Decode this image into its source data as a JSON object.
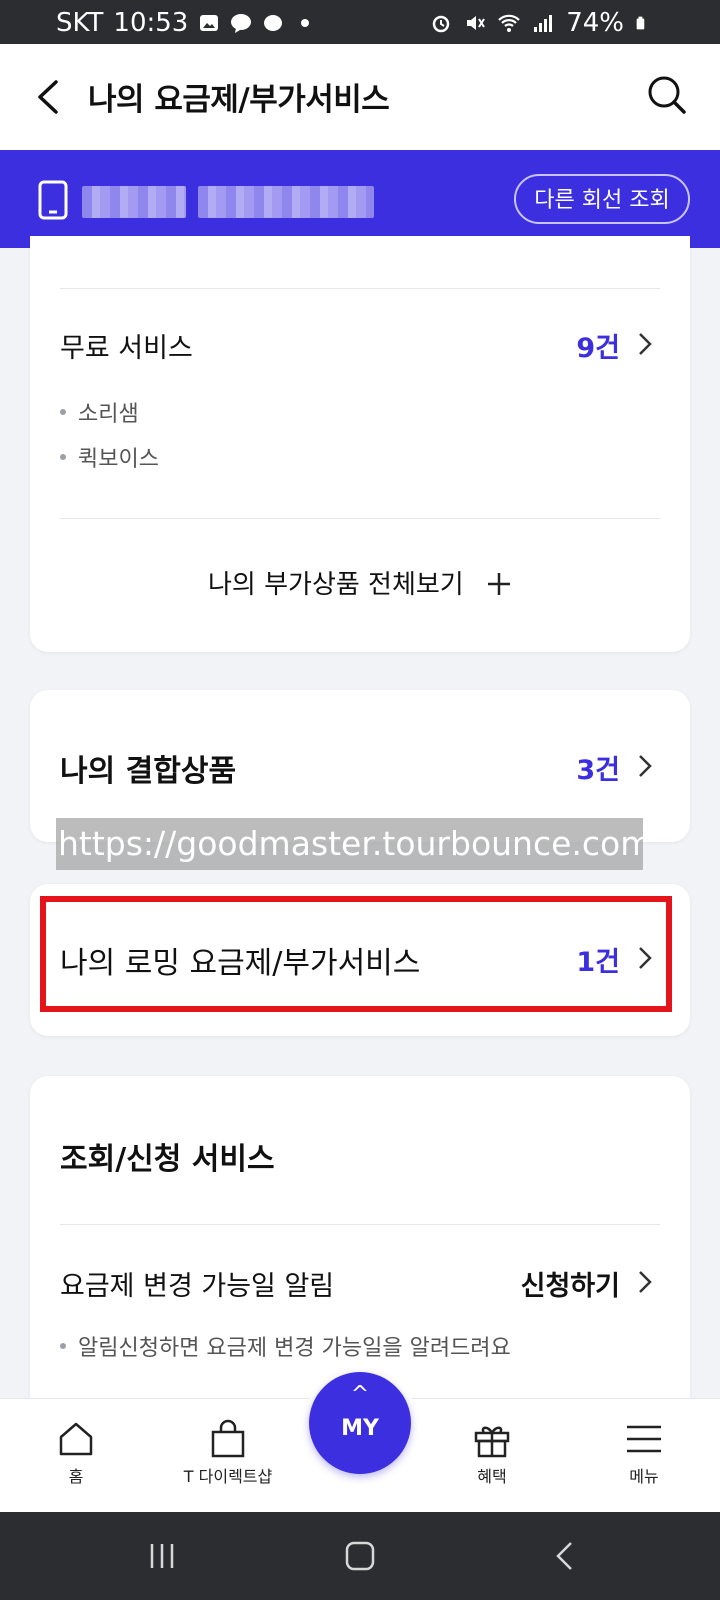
{
  "status": {
    "carrier": "SKT",
    "time": "10:53",
    "battery": "74%"
  },
  "header": {
    "title": "나의 요금제/부가서비스"
  },
  "line": {
    "other_line_button": "다른 회선 조회"
  },
  "free_services": {
    "label": "무료 서비스",
    "count": "9건",
    "items": [
      "소리샘",
      "퀵보이스"
    ],
    "view_all": "나의 부가상품 전체보기"
  },
  "combined": {
    "label": "나의 결합상품",
    "count": "3건"
  },
  "watermark": "https://goodmaster.tourbounce.com",
  "roaming": {
    "label": "나의 로밍 요금제/부가서비스",
    "count": "1건"
  },
  "inquiry": {
    "title": "조회/신청 서비스",
    "row_label": "요금제 변경 가능일 알림",
    "action": "신청하기",
    "note": "알림신청하면 요금제 변경 가능일을 알려드려요"
  },
  "bottom_nav": {
    "home": "홈",
    "direct": "T 다이렉트샵",
    "my_caret": "^",
    "my": "MY",
    "benefit": "혜택",
    "menu": "메뉴"
  },
  "colors": {
    "accent": "#3c2fe0",
    "highlight": "#e3151a"
  }
}
